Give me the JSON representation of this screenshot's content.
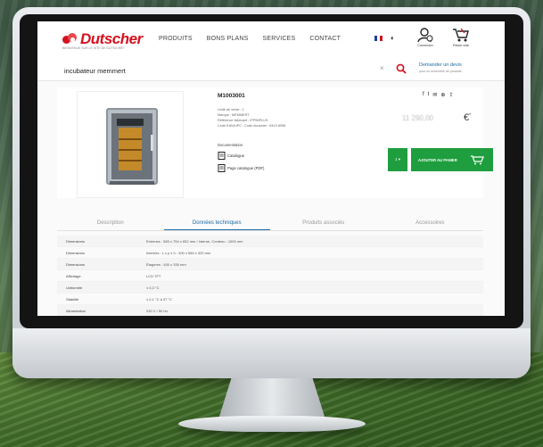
{
  "site": {
    "brand": "Dutscher",
    "tagline": "BIENVENUE SUR LE SITE DE DUTSCHER",
    "brand_color": "#d3121f",
    "accent_color": "#1b6aa5",
    "action_color": "#1e9e3e"
  },
  "nav": {
    "items": [
      "PRODUITS",
      "BONS PLANS",
      "SERVICES",
      "CONTACT"
    ]
  },
  "header": {
    "language_flag_icon": "flag-france-icon",
    "account_label": "Connexion",
    "cart_label": "Panier vide"
  },
  "search": {
    "value": "incubateur memmert",
    "clear_glyph": "×",
    "button_icon": "search-icon",
    "quote_link": "Demander un devis",
    "quote_sub": "pour un ensemble de produits"
  },
  "product": {
    "reference": "M1003001",
    "share_icons": [
      "facebook-icon",
      "twitter-icon",
      "email-icon",
      "print-icon",
      "share-icon"
    ],
    "share_glyphs": [
      "f",
      "t",
      "✉",
      "⊕",
      "⇪"
    ],
    "specs": [
      "Unité de vente : 1",
      "Marque : MEMMERT",
      "Référence fabricant : IPP55PLUS",
      "Code EAN/UPC : Code douanier : 8419 8998"
    ],
    "price": "11 290,00",
    "currency": "€",
    "price_suffix": "*",
    "docs_title": "Documentation",
    "docs": [
      "Catalogue",
      "Page catalogue (PDF)"
    ],
    "qty_button": "1 ▾",
    "add_to_cart": "AJOUTER AU PANIER"
  },
  "tabs": {
    "items": [
      "Description",
      "Données techniques",
      "Produits associés",
      "Accessoires"
    ],
    "active_index": 1
  },
  "tech_table": {
    "rows": [
      {
        "key": "Dimensions",
        "value": "Externes : 585 x 754 x 652 mm / Interne, Contenu : 1000 mm"
      },
      {
        "key": "Dimensions",
        "value": "Internes : L x p x h : 400 x 560 x 320 mm"
      },
      {
        "key": "Dimensions",
        "value": "Étagères : 400 x 330 mm"
      },
      {
        "key": "Affichage",
        "value": "LCD TFT"
      },
      {
        "key": "Uniformité",
        "value": "± 0,3 °C"
      },
      {
        "key": "Stabilité",
        "value": "± 0,1 °C à 37 °C"
      },
      {
        "key": "Alimentation",
        "value": "230 V / 50 Hz"
      }
    ]
  }
}
